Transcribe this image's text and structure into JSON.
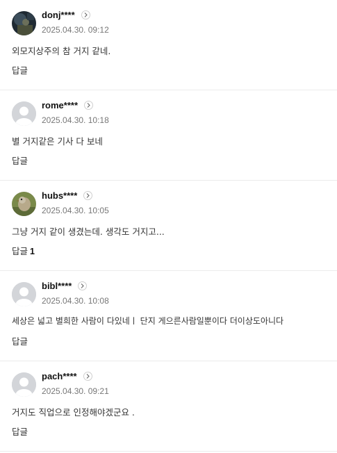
{
  "comments": [
    {
      "nickname": "donj****",
      "date": "2025.04.30. 09:12",
      "text": "외모지상주의 참 거지 같네.",
      "reply_label": "답글",
      "reply_count": "",
      "avatar": "photo-dark"
    },
    {
      "nickname": "rome****",
      "date": "2025.04.30. 10:18",
      "text": "별 거지같은 기사 다 보네",
      "reply_label": "답글",
      "reply_count": "",
      "avatar": "default-user-icon"
    },
    {
      "nickname": "hubs****",
      "date": "2025.04.30. 10:05",
      "text": "그냥 거지 같이 생겼는데. 생각도 거지고...",
      "reply_label": "답글",
      "reply_count": "1",
      "avatar": "photo-bird"
    },
    {
      "nickname": "bibl****",
      "date": "2025.04.30. 10:08",
      "text": "세상은 넓고 별희한 사람이 다있네ㅣ  단지 게으른사람일뿐이다 더이상도아니다",
      "reply_label": "답글",
      "reply_count": "",
      "avatar": "default-user-icon"
    },
    {
      "nickname": "pach****",
      "date": "2025.04.30. 09:21",
      "text": "거지도 직업으로 인정해야겠군요 .",
      "reply_label": "답글",
      "reply_count": "",
      "avatar": "default-user-icon"
    }
  ],
  "colors": {
    "nickname": "#111111",
    "date": "#777777",
    "text": "#333333",
    "divider": "#ebebeb",
    "default_avatar": "#d3d5d9"
  }
}
